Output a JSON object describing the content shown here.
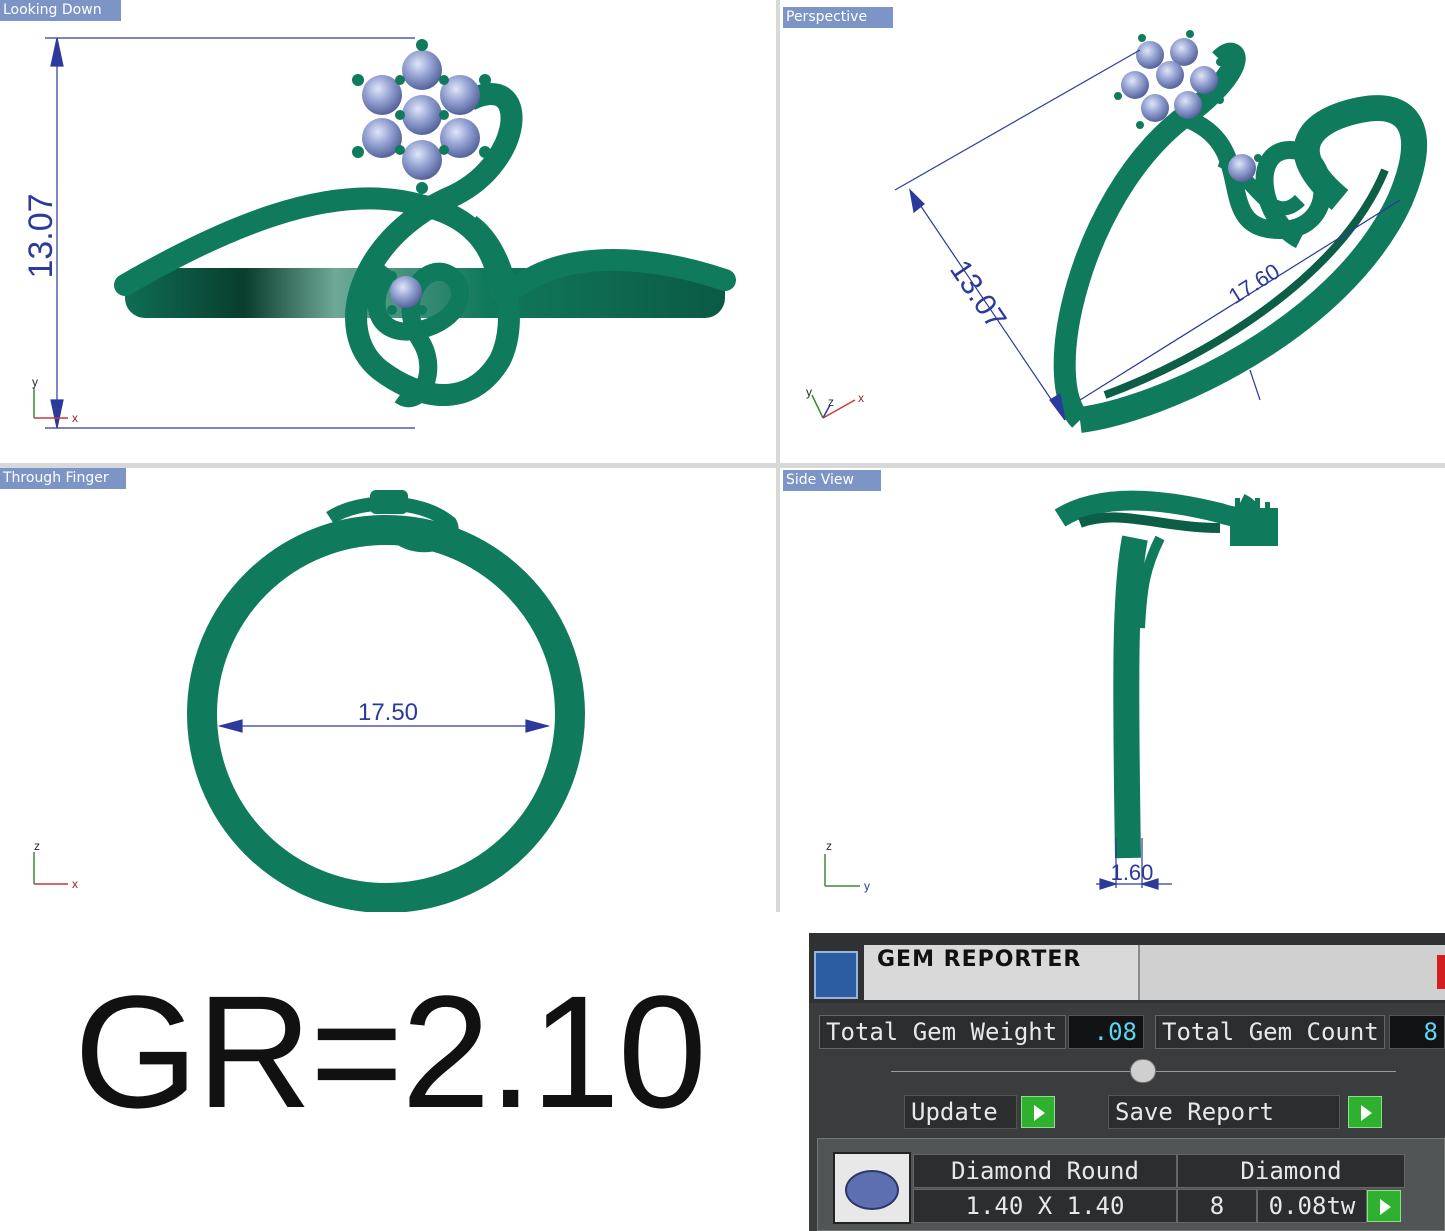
{
  "viewports": {
    "top_left": {
      "title": "Looking Down",
      "dimension": "13.07",
      "axis_y": "y",
      "axis_x": "x"
    },
    "top_right": {
      "title": "Perspective",
      "dimension_a": "13.07",
      "dimension_b": "17.60",
      "axis_y": "y",
      "axis_z": "z",
      "axis_x": "x"
    },
    "bottom_left": {
      "title": "Through Finger",
      "dimension": "17.50",
      "axis_z": "z",
      "axis_x": "x"
    },
    "bottom_right": {
      "title": "Side View",
      "dimension": "1.60",
      "axis_z": "z",
      "axis_y": "y"
    }
  },
  "gr_label": "GR=2.10",
  "gem_reporter": {
    "title": "GEM REPORTER",
    "total_weight_label": "Total Gem Weight",
    "total_weight_value": ".08",
    "total_count_label": "Total Gem Count",
    "total_count_value": "8",
    "update_label": "Update",
    "save_label": "Save Report",
    "row": {
      "name": "Diamond Round",
      "type": "Diamond",
      "size": "1.40 X 1.40",
      "count": "8",
      "weight": "0.08tw"
    }
  },
  "colors": {
    "metal": "#0f7a5c",
    "gem": "#8d9ccf",
    "dimension": "#2b3a9b",
    "viewport_title_bg": "#7d95c6"
  }
}
